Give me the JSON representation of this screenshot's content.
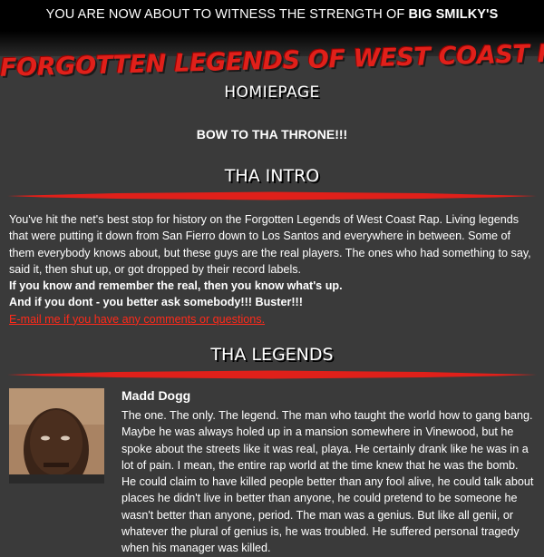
{
  "header": {
    "tagline_prefix": "YOU ARE NOW ABOUT TO WITNESS THE STRENGTH OF",
    "tagline_bold": "BIG SMILKY'S",
    "title": "FORGOTTEN LEGENDS OF WEST COAST RAP",
    "subtitle": "HOMIEPAGE"
  },
  "bow_text": "BOW TO THA THRONE!!!",
  "intro": {
    "heading": "THA INTRO",
    "paragraph": "You've hit the net's best stop for history on the Forgotten Legends of West Coast Rap. Living legends that were putting it down from San Fierro down to Los Santos and everywhere in between. Some of them everybody knows about, but these guys are the real players. The ones who had something to say, said it, then shut up, or got dropped by their record labels.",
    "bold_line_1": "If you know and remember the real, then you know what's up.",
    "bold_line_2": "And if you dont - you better ask somebody!!! Buster!!!",
    "email_link": "E-mail me if you have any comments or questions."
  },
  "legends": {
    "heading": "THA LEGENDS",
    "items": [
      {
        "name": "Madd Dogg",
        "bio": "The one. The only. The legend. The man who taught the world how to gang bang. Maybe he was always holed up in a mansion somewhere in Vinewood, but he spoke about the streets like it was real, playa. He certainly drank like he was in a lot of pain. I mean, the entire rap world at the time knew that he was the bomb. He could claim to have killed people better than any fool alive, he could talk about places he didn't live in better than anyone, he could pretend to be someone he wasn't better than anyone, period. The man was a genius. But like all genii, or whatever the plural of genius is, he was troubled. He suffered personal tragedy when his manager was killed."
      }
    ]
  },
  "colors": {
    "background": "#3a3a3a",
    "accent_red": "#e0201a",
    "link_red": "#ff2a1a"
  }
}
